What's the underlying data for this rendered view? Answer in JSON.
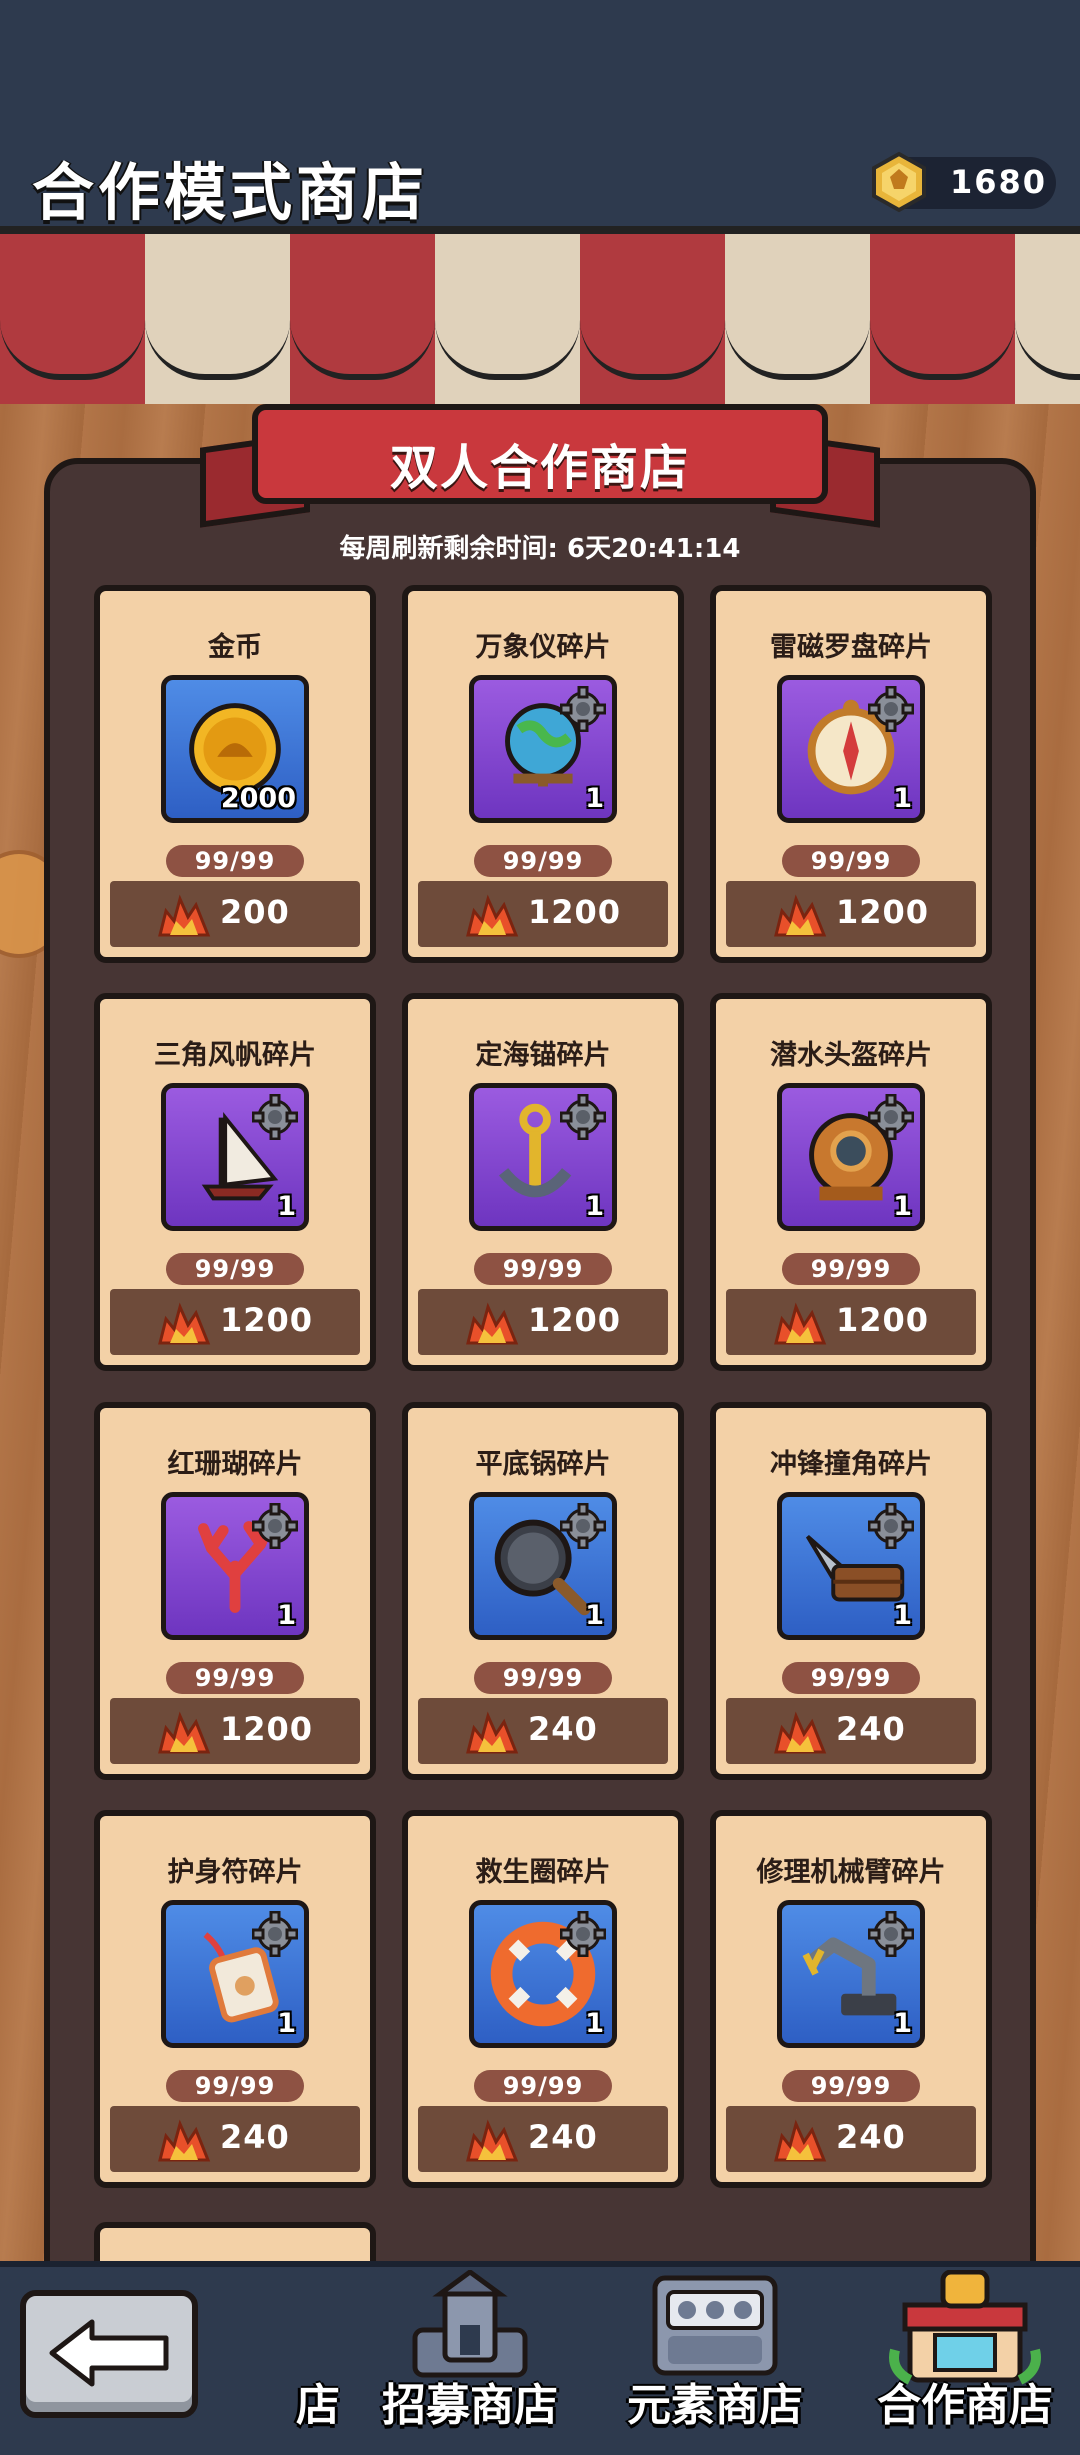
{
  "header": {
    "title": "合作模式商店",
    "currency_value": "1680"
  },
  "shop": {
    "banner_title": "双人合作商店",
    "refresh_text": "每周刷新剩余时间: 6天20:41:14",
    "items": [
      {
        "name": "金币",
        "quantity": "2000",
        "stock": "99/99",
        "price": "200",
        "icon": "coin-icon",
        "bg": "blue"
      },
      {
        "name": "万象仪碎片",
        "quantity": "1",
        "stock": "99/99",
        "price": "1200",
        "icon": "globe-icon",
        "bg": "purple"
      },
      {
        "name": "雷磁罗盘碎片",
        "quantity": "1",
        "stock": "99/99",
        "price": "1200",
        "icon": "compass-icon",
        "bg": "purple"
      },
      {
        "name": "三角风帆碎片",
        "quantity": "1",
        "stock": "99/99",
        "price": "1200",
        "icon": "sail-icon",
        "bg": "purple"
      },
      {
        "name": "定海锚碎片",
        "quantity": "1",
        "stock": "99/99",
        "price": "1200",
        "icon": "anchor-icon",
        "bg": "purple"
      },
      {
        "name": "潜水头盔碎片",
        "quantity": "1",
        "stock": "99/99",
        "price": "1200",
        "icon": "diving-helmet-icon",
        "bg": "purple"
      },
      {
        "name": "红珊瑚碎片",
        "quantity": "1",
        "stock": "99/99",
        "price": "1200",
        "icon": "coral-icon",
        "bg": "purple"
      },
      {
        "name": "平底锅碎片",
        "quantity": "1",
        "stock": "99/99",
        "price": "240",
        "icon": "pan-icon",
        "bg": "blue"
      },
      {
        "name": "冲锋撞角碎片",
        "quantity": "1",
        "stock": "99/99",
        "price": "240",
        "icon": "ram-icon",
        "bg": "blue"
      },
      {
        "name": "护身符碎片",
        "quantity": "1",
        "stock": "99/99",
        "price": "240",
        "icon": "amulet-icon",
        "bg": "blue"
      },
      {
        "name": "救生圈碎片",
        "quantity": "1",
        "stock": "99/99",
        "price": "240",
        "icon": "lifebuoy-icon",
        "bg": "blue"
      },
      {
        "name": "修理机械臂碎片",
        "quantity": "1",
        "stock": "99/99",
        "price": "240",
        "icon": "robot-arm-icon",
        "bg": "blue"
      }
    ]
  },
  "nav": {
    "partial_label": "店",
    "tabs": [
      {
        "label": "招募商店",
        "icon": "tower-icon"
      },
      {
        "label": "元素商店",
        "icon": "slot-machine-icon"
      },
      {
        "label": "合作商店",
        "icon": "fist-shop-icon"
      }
    ],
    "active_tab": "合作商店"
  }
}
